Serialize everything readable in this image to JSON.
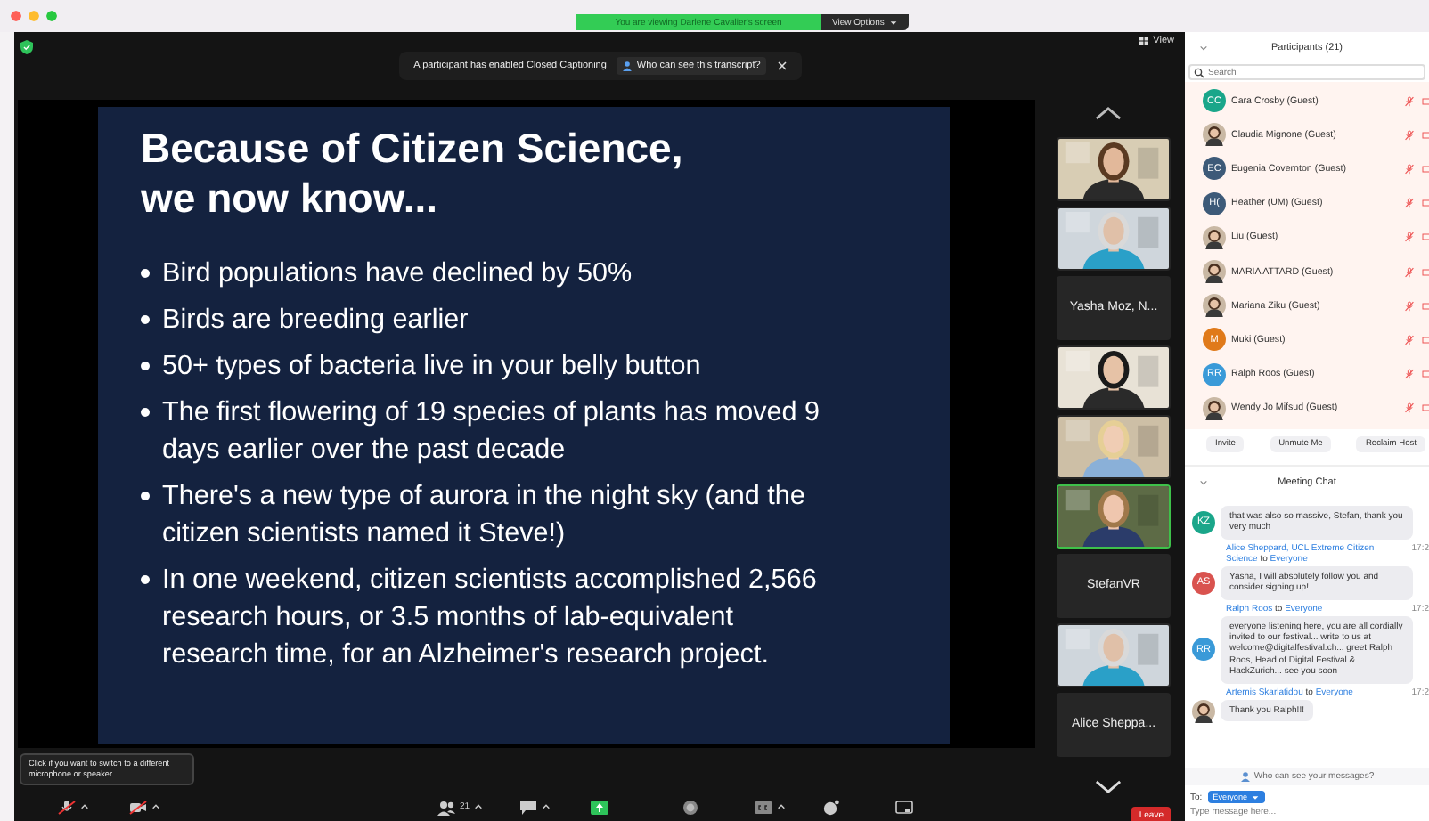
{
  "window": {
    "banner": "You are viewing Darlene Cavalier's screen",
    "view_options": "View Options"
  },
  "caption_notice": {
    "text": "A participant has enabled Closed Captioning",
    "button": "Who can see this transcript?"
  },
  "view_button": "View",
  "slide": {
    "title_lines": [
      "Because of Citizen Science,",
      "we now know..."
    ],
    "bullets": [
      "Bird populations have declined by 50%",
      "Birds are breeding earlier",
      "50+ types of bacteria live in your belly button",
      "The first flowering of 19 species of plants has moved 9 days earlier over the past decade",
      "There's a new type of aurora in the night sky (and the citizen scientists named it Steve!)",
      "In one weekend, citizen scientists accomplished 2,566 research hours, or 3.5 months of lab-equivalent research time, for an Alzheimer's research project."
    ]
  },
  "video_tiles": [
    {
      "kind": "video",
      "active": false
    },
    {
      "kind": "video",
      "active": false
    },
    {
      "kind": "name",
      "active": false,
      "name": "Yasha Moz, N..."
    },
    {
      "kind": "video",
      "active": false
    },
    {
      "kind": "video",
      "active": false
    },
    {
      "kind": "video",
      "active": true
    },
    {
      "kind": "name",
      "active": false,
      "name": "StefanVR"
    },
    {
      "kind": "video",
      "active": false
    },
    {
      "kind": "name",
      "active": false,
      "name": "Alice Sheppa..."
    }
  ],
  "tooltip": "Click if you want to switch to a different microphone or speaker",
  "toolbar": [
    {
      "kind": "mic",
      "muted": true,
      "caret": true
    },
    {
      "kind": "video",
      "muted": true,
      "caret": true
    },
    {
      "kind": "participants",
      "count": "21",
      "caret": true
    },
    {
      "kind": "chat",
      "caret": true
    },
    {
      "kind": "share",
      "caret": false
    },
    {
      "kind": "record",
      "caret": false
    },
    {
      "kind": "cc",
      "caret": true
    },
    {
      "kind": "reactions",
      "caret": false
    },
    {
      "kind": "whiteboard",
      "caret": false
    }
  ],
  "leave_button": "Leave",
  "participants": {
    "title": "Participants (21)",
    "search_placeholder": "Search",
    "items": [
      {
        "name": "Cara Crosby (Guest)",
        "avatar": {
          "kind": "initials",
          "initials": "CC",
          "color": "#1aa68a"
        },
        "muted": true
      },
      {
        "name": "Claudia Mignone (Guest)",
        "muted": true
      },
      {
        "name": "Eugenia Covernton (Guest)",
        "avatar": {
          "kind": "initials",
          "initials": "EC",
          "color": "#3d5a78"
        },
        "muted": true
      },
      {
        "name": "Heather (UM) (Guest)",
        "avatar": {
          "kind": "initials",
          "initials": "H(",
          "color": "#3d5a78"
        },
        "muted": true
      },
      {
        "name": "Liu (Guest)",
        "muted": true
      },
      {
        "name": "MARIA ATTARD (Guest)",
        "muted": true
      },
      {
        "name": "Mariana Ziku (Guest)",
        "muted": true
      },
      {
        "name": "Muki (Guest)",
        "avatar": {
          "kind": "initials",
          "initials": "M",
          "color": "#e07a1a"
        },
        "muted": true
      },
      {
        "name": "Ralph Roos (Guest)",
        "avatar": {
          "kind": "initials",
          "initials": "RR",
          "color": "#3a9ad8"
        },
        "muted": true
      },
      {
        "name": "Wendy Jo Mifsud (Guest)",
        "muted": true
      }
    ],
    "buttons": [
      "Invite",
      "Unmute Me",
      "Reclaim Host"
    ]
  },
  "chat": {
    "title": "Meeting Chat",
    "messages": [
      {
        "avatar": {
          "kind": "initials",
          "initials": "KZ",
          "color": "#1aa68a"
        },
        "text": "that was also so massive, Stefan, thank you very much"
      },
      {
        "sender": "Alice Sheppard, UCL Extreme Citizen Science",
        "to": "to",
        "recipient": "Everyone",
        "time": "17:2",
        "avatar": {
          "kind": "initials",
          "initials": "AS",
          "color": "#d9534f"
        },
        "text": "Yasha, I will absolutely follow you and consider signing up!"
      },
      {
        "sender": "Ralph Roos",
        "to": "to",
        "recipient": "Everyone",
        "time": "17:2",
        "avatar": {
          "kind": "initials",
          "initials": "RR",
          "color": "#3a9ad8"
        },
        "text": "everyone listening here, you are all cordially invited to our festival... write to us at welcome@digitalfestival.ch... greet Ralph Roos, Head of Digital Festival & HackZurich... see you soon"
      },
      {
        "sender": "Artemis Skarlatidou",
        "to": "to",
        "recipient": "Everyone",
        "time": "17:2",
        "text": "Thank you Ralph!!!"
      }
    ],
    "privacy": "Who can see your messages?",
    "to_label": "To:",
    "recipient": "Everyone",
    "placeholder": "Type message here..."
  }
}
